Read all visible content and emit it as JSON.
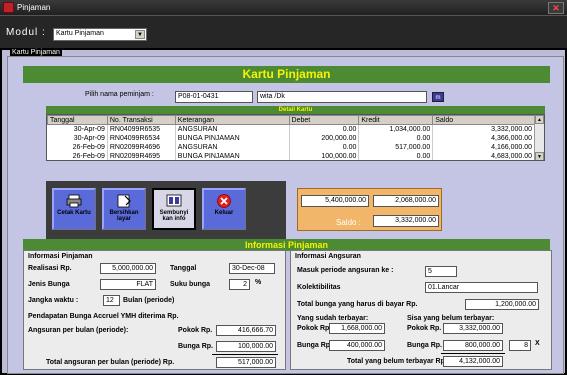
{
  "window": {
    "title": "Pinjaman"
  },
  "modul": {
    "label": "Modul :",
    "value": "Kartu Pinjaman"
  },
  "fieldset": {
    "label": "Kartu Pinjaman"
  },
  "kartu": {
    "title": "Kartu Pinjaman"
  },
  "pilih": {
    "label": "Pilih nama peminjam :",
    "id_value": "P08-01-0431",
    "name_value": "wita /Dk",
    "lookup_label": "m"
  },
  "table": {
    "caption": "Detail Kartu",
    "columns": [
      "Tanggal",
      "No. Transaksi",
      "Keterangan",
      "Debet",
      "Kredit",
      "Saldo"
    ],
    "rows": [
      [
        "30-Apr-09",
        "RN04099R6535",
        "ANGSURAN",
        "0.00",
        "1,034,000.00",
        "3,332,000.00"
      ],
      [
        "30-Apr-09",
        "RN04099R6534",
        "BUNGA PINJAMAN",
        "200,000.00",
        "0.00",
        "4,366,000.00"
      ],
      [
        "26-Feb-09",
        "RN02099R4696",
        "ANGSURAN",
        "0.00",
        "517,000.00",
        "4,166,000.00"
      ],
      [
        "26-Feb-09",
        "RN02099R4695",
        "BUNGA PINJAMAN",
        "100,000.00",
        "0.00",
        "4,683,000.00"
      ]
    ]
  },
  "buttons": {
    "cetak": "Cetak Kartu",
    "bersihkan": "Bersihkan layar",
    "sembunyi": "Sembunyi kan info",
    "keluar": "Keluar"
  },
  "totals": {
    "debet": "5,400,000.00",
    "kredit": "2,068,000.00",
    "saldo_label": "Saldo :",
    "saldo": "3,332,000.00"
  },
  "informasi": {
    "title": "Informasi Pinjaman"
  },
  "pinjaman": {
    "header": "Informasi Pinjaman",
    "realisasi_label": "Realisasi Rp.",
    "realisasi": "5,000,000.00",
    "tanggal_label": "Tanggal",
    "tanggal": "30-Dec-08",
    "jenis_label": "Jenis Bunga",
    "jenis": "FLAT",
    "suku_label": "Suku bunga",
    "suku": "2",
    "suku_unit": "%",
    "jangka_label": "Jangka waktu :",
    "jangka": "12",
    "jangka_unit": "Bulan (periode)",
    "pendapatan_label": "Pendapatan Bunga Accruel YMH diterima Rp.",
    "angsuran_label": "Angsuran per bulan (periode):",
    "pokok_label": "Pokok Rp.",
    "pokok": "416,666.70",
    "bunga_label": "Bunga Rp.",
    "bunga": "100,000.00",
    "total_label": "Total angsuran per bulan (periode) Rp.",
    "total": "517,000.00"
  },
  "angsuran": {
    "header": "Informasi Angsuran",
    "masuk_label": "Masuk periode angsuran ke :",
    "masuk": "5",
    "kolek_label": "Kolektibilitas",
    "kolek": "01.Lancar",
    "total_bunga_label": "Total bunga yang harus di bayar Rp.",
    "total_bunga": "1,200,000.00",
    "sudah_label": "Yang sudah terbayar:",
    "sudah_pokok_label": "Pokok Rp.",
    "sudah_pokok": "1,668,000.00",
    "sudah_bunga_label": "Bunga Rp.",
    "sudah_bunga": "400,000.00",
    "sisa_label": "Sisa yang belum terbayar:",
    "sisa_pokok_label": "Pokok Rp.",
    "sisa_pokok": "3,332,000.00",
    "sisa_bunga_label": "Bunga Rp.",
    "sisa_bunga": "800,000.00",
    "sisa_kali": "8",
    "sisa_x": "X",
    "total_belum_label": "Total yang belum terbayar Rp.",
    "total_belum": "4,132,000.00"
  }
}
